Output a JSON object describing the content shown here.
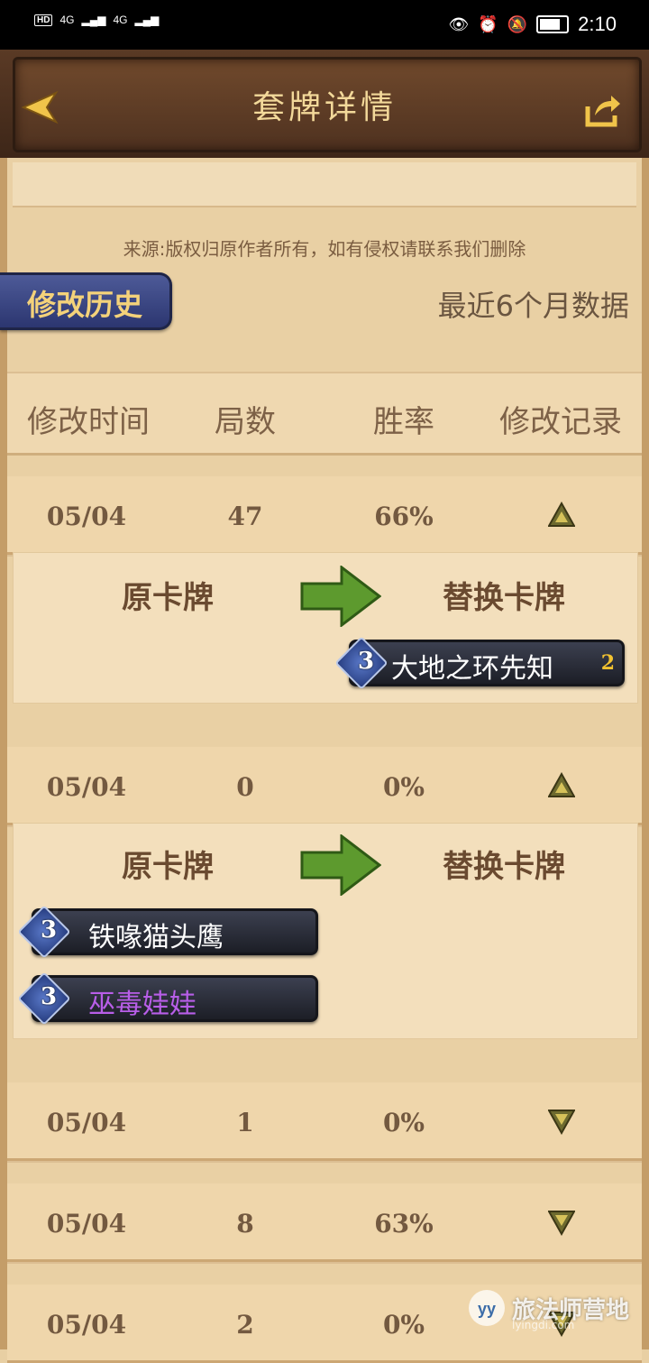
{
  "status_bar": {
    "left": [
      "HD",
      "4G",
      "4G"
    ],
    "time": "2:10"
  },
  "header": {
    "title": "套牌详情"
  },
  "source_note": "来源:版权归原作者所有，如有侵权请联系我们删除",
  "tab_label": "修改历史",
  "recent_label": "最近6个月数据",
  "table": {
    "headers": [
      "修改时间",
      "局数",
      "胜率",
      "修改记录"
    ],
    "rows": [
      {
        "date": "05/04",
        "games": "47",
        "winrate": "66%",
        "expanded": true,
        "detail": {
          "from_label": "原卡牌",
          "to_label": "替换卡牌",
          "removed": [],
          "added": [
            {
              "cost": "3",
              "name": "大地之环先知",
              "count": "2"
            }
          ]
        }
      },
      {
        "date": "05/04",
        "games": "0",
        "winrate": "0%",
        "expanded": true,
        "detail": {
          "from_label": "原卡牌",
          "to_label": "替换卡牌",
          "removed": [
            {
              "cost": "3",
              "name": "铁喙猫头鹰"
            },
            {
              "cost": "3",
              "name": "巫毒娃娃",
              "rarity": "epic"
            }
          ],
          "added": []
        }
      },
      {
        "date": "05/04",
        "games": "1",
        "winrate": "0%",
        "expanded": false
      },
      {
        "date": "05/04",
        "games": "8",
        "winrate": "63%",
        "expanded": false
      },
      {
        "date": "05/04",
        "games": "2",
        "winrate": "0%",
        "expanded": false
      }
    ]
  },
  "watermark": {
    "text": "旅法师营地",
    "url": "lyingdi.com"
  },
  "colors": {
    "accent_gold": "#f3d99a",
    "tab_blue": "#3b478a",
    "epic_purple": "#b85ee8"
  },
  "icons": [
    "back-arrow-icon",
    "share-icon",
    "collapse-triangle-icon",
    "expand-triangle-icon",
    "green-arrow-icon",
    "mana-crystal-icon"
  ]
}
